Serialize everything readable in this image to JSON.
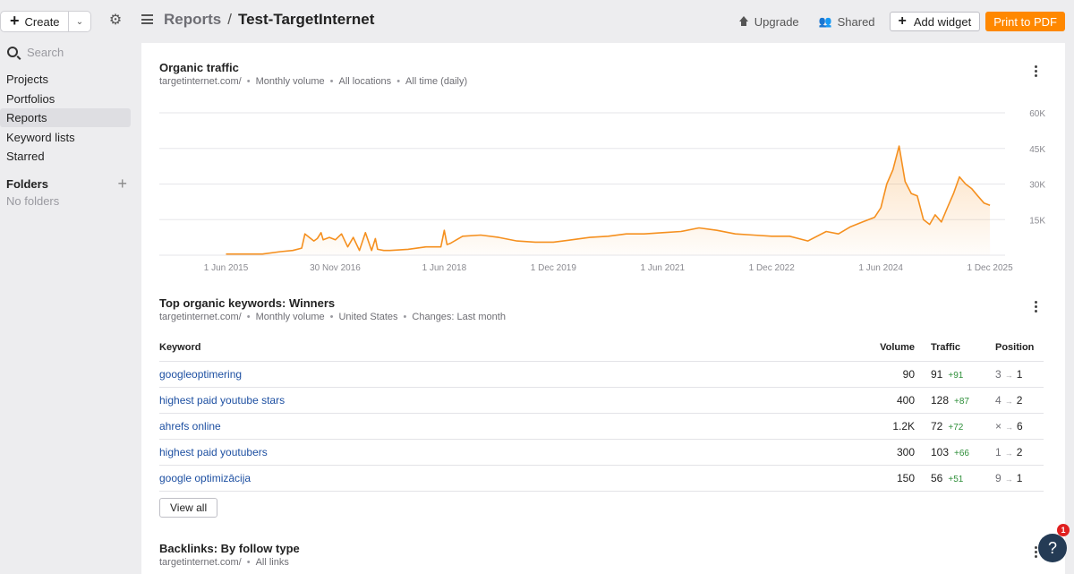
{
  "topbar": {
    "create_label": "Create",
    "breadcrumb_parent": "Reports",
    "breadcrumb_separator": "/",
    "breadcrumb_current": "Test-TargetInternet",
    "upgrade_label": "Upgrade",
    "shared_label": "Shared",
    "add_widget_label": "Add widget",
    "print_label": "Print to PDF",
    "accent_color": "#ff8800"
  },
  "sidebar": {
    "search_placeholder": "Search",
    "items": [
      {
        "label": "Projects",
        "active": false
      },
      {
        "label": "Portfolios",
        "active": false
      },
      {
        "label": "Reports",
        "active": true
      },
      {
        "label": "Keyword lists",
        "active": false
      },
      {
        "label": "Starred",
        "active": false
      }
    ],
    "folders_title": "Folders",
    "no_folders": "No folders"
  },
  "organic_traffic": {
    "title": "Organic traffic",
    "meta": [
      "targetinternet.com/",
      "Monthly volume",
      "All locations",
      "All time (daily)"
    ]
  },
  "chart_data": {
    "type": "area",
    "title": "Organic traffic",
    "color": "#f5901f",
    "y_ticks": [
      "60K",
      "45K",
      "30K",
      "15K"
    ],
    "y_tick_values": [
      60000,
      45000,
      30000,
      15000
    ],
    "ylim": [
      0,
      60000
    ],
    "x_ticks": [
      "1 Jun 2015",
      "30 Nov 2016",
      "1 Jun 2018",
      "1 Dec 2019",
      "1 Jun 2021",
      "1 Dec 2022",
      "1 Jun 2024",
      "1 Dec 2025"
    ],
    "x_tick_values": [
      "2015-06-01",
      "2016-11-30",
      "2018-06-01",
      "2019-12-01",
      "2021-06-01",
      "2022-12-01",
      "2024-06-01",
      "2025-12-01"
    ],
    "grid": true,
    "series": [
      {
        "x": [
          "2015-06-01",
          "2015-12-01",
          "2016-03-01",
          "2016-05-01",
          "2016-06-15",
          "2016-07-01",
          "2016-08-15",
          "2016-09-01",
          "2016-09-20",
          "2016-10-01",
          "2016-11-01",
          "2016-12-01",
          "2017-01-01",
          "2017-02-01",
          "2017-03-01",
          "2017-04-01",
          "2017-05-01",
          "2017-06-01",
          "2017-06-20",
          "2017-07-01",
          "2017-08-01",
          "2017-09-01",
          "2017-12-01",
          "2018-03-01",
          "2018-05-15",
          "2018-06-01",
          "2018-06-15",
          "2018-07-01",
          "2018-09-01",
          "2018-12-01",
          "2019-03-01",
          "2019-06-01",
          "2019-09-01",
          "2019-12-01",
          "2020-03-01",
          "2020-06-01",
          "2020-09-01",
          "2020-12-01",
          "2021-03-01",
          "2021-06-01",
          "2021-09-01",
          "2021-12-01",
          "2022-03-01",
          "2022-06-01",
          "2022-09-01",
          "2022-12-01",
          "2023-03-01",
          "2023-06-01",
          "2023-09-01",
          "2023-11-01",
          "2024-01-01",
          "2024-03-01",
          "2024-05-01",
          "2024-06-01",
          "2024-07-01",
          "2024-08-01",
          "2024-09-01",
          "2024-10-01",
          "2024-11-01",
          "2024-12-01",
          "2025-01-01",
          "2025-02-01",
          "2025-03-01",
          "2025-04-01",
          "2025-05-01",
          "2025-06-01",
          "2025-07-01",
          "2025-08-01",
          "2025-09-01",
          "2025-10-01",
          "2025-11-01",
          "2025-12-01"
        ],
        "y": [
          500,
          500,
          1500,
          2000,
          3000,
          9000,
          6000,
          7000,
          9500,
          6500,
          7500,
          6500,
          9000,
          3500,
          7500,
          2000,
          9500,
          2000,
          7000,
          2500,
          2000,
          2000,
          2500,
          3500,
          3500,
          10500,
          4500,
          5000,
          8000,
          8500,
          7500,
          6000,
          5500,
          5500,
          6500,
          7500,
          8000,
          9000,
          9000,
          9500,
          10000,
          11500,
          10500,
          9000,
          8500,
          8000,
          8000,
          6000,
          10000,
          9000,
          12000,
          14000,
          16000,
          20000,
          30000,
          36000,
          46000,
          31000,
          26000,
          25000,
          15000,
          13000,
          17000,
          14000,
          20000,
          26000,
          33000,
          30000,
          28000,
          25000,
          22000,
          21000
        ]
      }
    ]
  },
  "winners": {
    "title": "Top organic keywords: Winners",
    "meta": [
      "targetinternet.com/",
      "Monthly volume",
      "United States",
      "Changes: Last month"
    ],
    "columns": {
      "keyword": "Keyword",
      "volume": "Volume",
      "traffic": "Traffic",
      "position": "Position"
    },
    "rows": [
      {
        "keyword": "googleoptimering",
        "volume": "90",
        "traffic": "91",
        "delta": "+91",
        "pos_from": "3",
        "pos_to": "1"
      },
      {
        "keyword": "highest paid youtube stars",
        "volume": "400",
        "traffic": "128",
        "delta": "+87",
        "pos_from": "4",
        "pos_to": "2"
      },
      {
        "keyword": "ahrefs online",
        "volume": "1.2K",
        "traffic": "72",
        "delta": "+72",
        "pos_from": "×",
        "pos_to": "6"
      },
      {
        "keyword": "highest paid youtubers",
        "volume": "300",
        "traffic": "103",
        "delta": "+66",
        "pos_from": "1",
        "pos_to": "2"
      },
      {
        "keyword": "google optimizācija",
        "volume": "150",
        "traffic": "56",
        "delta": "+51",
        "pos_from": "9",
        "pos_to": "1"
      }
    ],
    "pos_arrow": "→",
    "view_all_label": "View all"
  },
  "backlinks": {
    "title": "Backlinks: By follow type",
    "meta": [
      "targetinternet.com/",
      "All links"
    ]
  },
  "help": {
    "label": "?",
    "badge": "1"
  }
}
